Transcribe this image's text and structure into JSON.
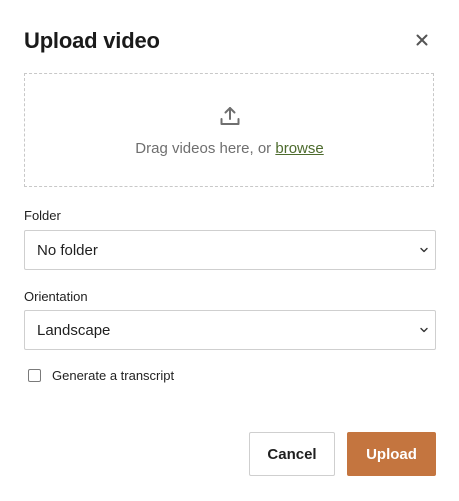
{
  "dialog": {
    "title": "Upload video",
    "close_icon": "close-icon"
  },
  "dropzone": {
    "icon": "upload-icon",
    "prefix_text": "Drag videos here, or ",
    "browse_link": "browse"
  },
  "folder": {
    "label": "Folder",
    "selected": "No folder"
  },
  "orientation": {
    "label": "Orientation",
    "selected": "Landscape"
  },
  "transcript": {
    "label": "Generate a transcript",
    "checked": false
  },
  "actions": {
    "cancel_label": "Cancel",
    "upload_label": "Upload"
  },
  "colors": {
    "accent": "#c4753f",
    "link": "#4d6b2d"
  }
}
